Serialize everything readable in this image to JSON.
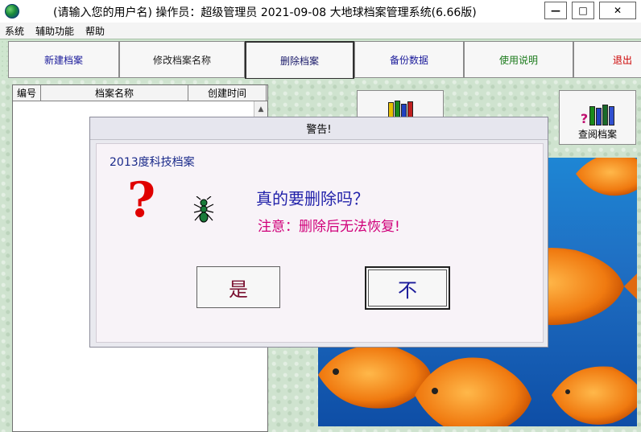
{
  "window": {
    "title": "(请输入您的用户名)  操作员：超级管理员  2021-09-08  大地球档案管理系统(6.66版)",
    "minimize": "—",
    "restore": "□",
    "close": "✕"
  },
  "menu": [
    "系统",
    "辅助功能",
    "帮助"
  ],
  "toolbar": [
    {
      "label": "新建档案",
      "color": "#1a1a9a"
    },
    {
      "label": "修改档案名称",
      "color": "#222222"
    },
    {
      "label": "删除档案",
      "color": "#1a1a6a"
    },
    {
      "label": "备份数据",
      "color": "#1a1a9a"
    },
    {
      "label": "使用说明",
      "color": "#1a7a1a"
    },
    {
      "label": "退出",
      "color": "#cc0000"
    }
  ],
  "list": {
    "columns": [
      "编号",
      "档案名称",
      "创建时间"
    ]
  },
  "side_buttons": {
    "view_label": "查阅档案"
  },
  "dialog": {
    "title": "警告!",
    "archive_name": "2013度科技档案",
    "question": "真的要删除吗？",
    "warning": "注意：删除后无法恢复!",
    "yes": "是",
    "no": "不"
  }
}
